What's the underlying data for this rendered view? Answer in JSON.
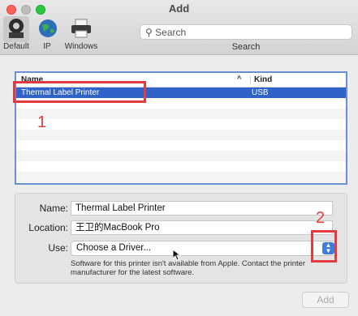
{
  "window": {
    "title": "Add"
  },
  "toolbar": {
    "default_label": "Default",
    "ip_label": "IP",
    "windows_label": "Windows",
    "search_placeholder": "Search",
    "search_caption": "Search"
  },
  "printer_list": {
    "header_name": "Name",
    "header_kind": "Kind",
    "sort_indicator": "^",
    "rows": [
      {
        "name": "Thermal Label Printer",
        "kind": "USB",
        "selected": true
      }
    ],
    "empty_rows": 7
  },
  "form": {
    "name_label": "Name:",
    "name_value": "Thermal Label Printer",
    "location_label": "Location:",
    "location_value": "王卫的MacBook Pro",
    "use_label": "Use:",
    "use_value": "Choose a Driver...",
    "note": "Software for this printer isn't available from Apple. Contact the printer manufacturer for the latest software."
  },
  "annotations": {
    "label_1": "1",
    "label_2": "2",
    "color": "#e23b3b"
  },
  "footer": {
    "add_label": "Add"
  }
}
